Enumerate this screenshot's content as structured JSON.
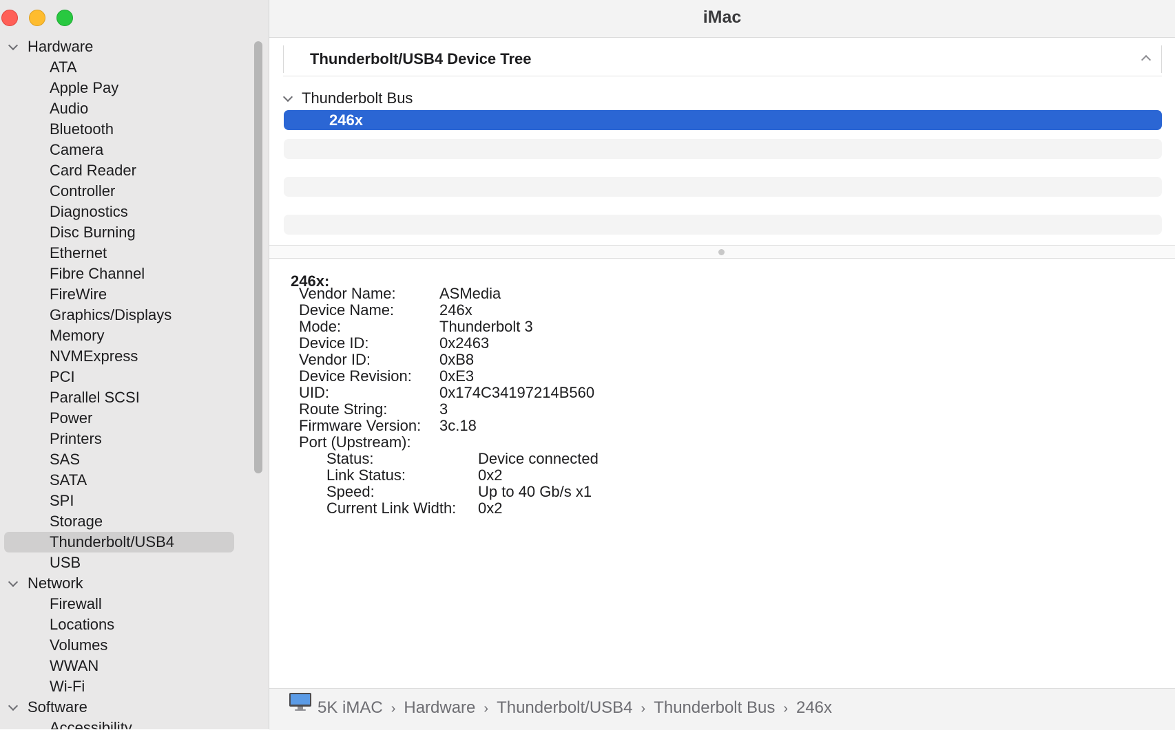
{
  "window": {
    "title": "iMac"
  },
  "sidebar": {
    "groups": [
      {
        "label": "Hardware",
        "items": [
          "ATA",
          "Apple Pay",
          "Audio",
          "Bluetooth",
          "Camera",
          "Card Reader",
          "Controller",
          "Diagnostics",
          "Disc Burning",
          "Ethernet",
          "Fibre Channel",
          "FireWire",
          "Graphics/Displays",
          "Memory",
          "NVMExpress",
          "PCI",
          "Parallel SCSI",
          "Power",
          "Printers",
          "SAS",
          "SATA",
          "SPI",
          "Storage",
          "Thunderbolt/USB4",
          "USB"
        ]
      },
      {
        "label": "Network",
        "items": [
          "Firewall",
          "Locations",
          "Volumes",
          "WWAN",
          "Wi-Fi"
        ]
      },
      {
        "label": "Software",
        "items": [
          "Accessibility"
        ]
      }
    ],
    "selected": "Thunderbolt/USB4"
  },
  "tree": {
    "header": "Thunderbolt/USB4 Device Tree",
    "bus": "Thunderbolt Bus",
    "device": "246x"
  },
  "detail": {
    "title": "246x:",
    "properties": [
      {
        "label": "Vendor Name:",
        "value": "ASMedia"
      },
      {
        "label": "Device Name:",
        "value": "246x"
      },
      {
        "label": "Mode:",
        "value": "Thunderbolt 3"
      },
      {
        "label": "Device ID:",
        "value": "0x2463"
      },
      {
        "label": "Vendor ID:",
        "value": "0xB8"
      },
      {
        "label": "Device Revision:",
        "value": "0xE3"
      },
      {
        "label": "UID:",
        "value": "0x174C34197214B560"
      },
      {
        "label": "Route String:",
        "value": "3"
      },
      {
        "label": "Firmware Version:",
        "value": "3c.18"
      }
    ],
    "port_label": "Port (Upstream):",
    "port_properties": [
      {
        "label": "Status:",
        "value": "Device connected"
      },
      {
        "label": "Link Status:",
        "value": "0x2"
      },
      {
        "label": "Speed:",
        "value": "Up to 40 Gb/s x1"
      },
      {
        "label": "Current Link Width:",
        "value": "0x2"
      }
    ]
  },
  "path": {
    "computer_icon": "imac-icon",
    "crumbs": [
      "5K iMAC",
      "Hardware",
      "Thunderbolt/USB4",
      "Thunderbolt Bus",
      "246x"
    ]
  }
}
